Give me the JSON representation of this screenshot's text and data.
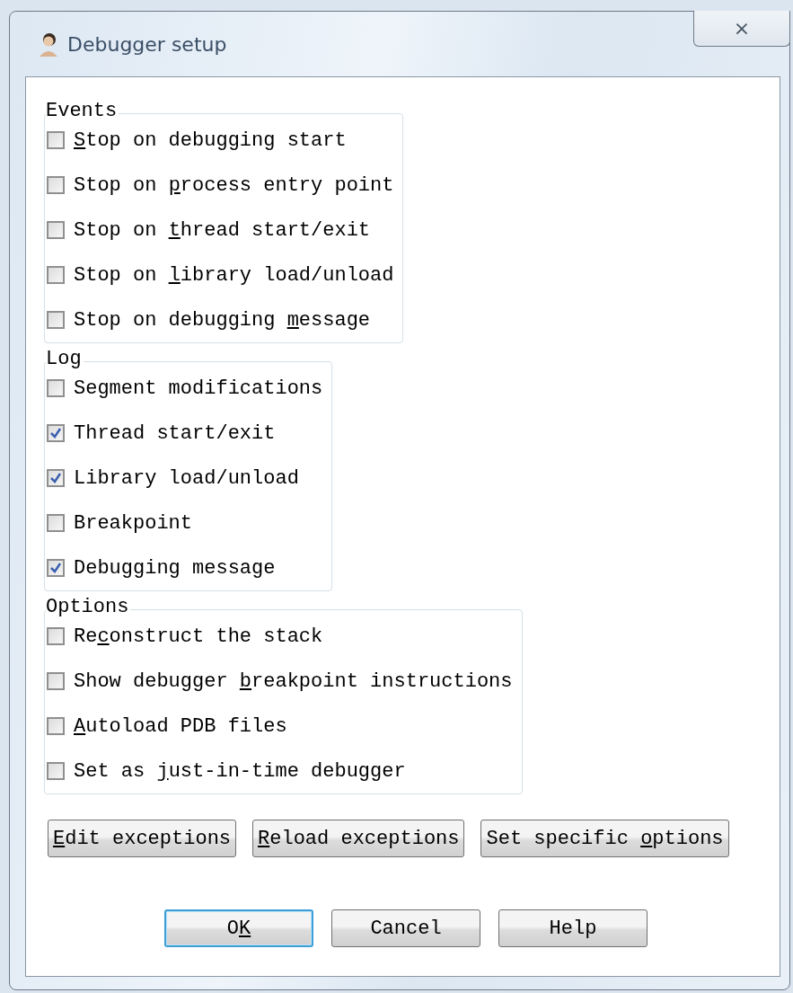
{
  "window": {
    "title": "Debugger setup",
    "close_button": "⨯"
  },
  "groups": [
    {
      "title": "Events",
      "items": [
        {
          "label": {
            "key": "S",
            "after": "top on debugging start"
          },
          "checked": false
        },
        {
          "label": {
            "before": "Stop on ",
            "key": "p",
            "after": "rocess entry point"
          },
          "checked": false
        },
        {
          "label": {
            "before": "Stop on ",
            "key": "t",
            "after": "hread start/exit"
          },
          "checked": false
        },
        {
          "label": {
            "before": "Stop on ",
            "key": "l",
            "after": "ibrary load/unload"
          },
          "checked": false
        },
        {
          "label": {
            "before": "Stop on debugging ",
            "key": "m",
            "after": "essage"
          },
          "checked": false
        }
      ]
    },
    {
      "title": "Log",
      "items": [
        {
          "label": "Segment modifications",
          "checked": false
        },
        {
          "label": "Thread start/exit",
          "checked": true
        },
        {
          "label": "Library load/unload",
          "checked": true
        },
        {
          "label": "Breakpoint",
          "checked": false
        },
        {
          "label": "Debugging message",
          "checked": true
        }
      ]
    },
    {
      "title": "Options",
      "items": [
        {
          "label": {
            "before": "Re",
            "key": "c",
            "after": "onstruct the stack"
          },
          "checked": false
        },
        {
          "label": {
            "before": "Show debugger ",
            "key": "b",
            "after": "reakpoint instructions"
          },
          "checked": false
        },
        {
          "label": {
            "key": "A",
            "after": "utoload PDB files"
          },
          "checked": false
        },
        {
          "label": {
            "before": "Set as ",
            "key": "j",
            "after": "ust-in-time debugger"
          },
          "checked": false
        }
      ]
    }
  ],
  "action_buttons": [
    {
      "label": {
        "key": "E",
        "after": "dit exceptions"
      }
    },
    {
      "label": {
        "key": "R",
        "after": "eload exceptions"
      }
    },
    {
      "label": {
        "before": "Set specific ",
        "key": "o",
        "after": "ptions"
      }
    }
  ],
  "dialog_buttons": [
    {
      "label": {
        "before": "O",
        "key": "K"
      },
      "focused": true
    },
    {
      "label": "Cancel",
      "focused": false
    },
    {
      "label": "Help",
      "focused": false
    }
  ]
}
